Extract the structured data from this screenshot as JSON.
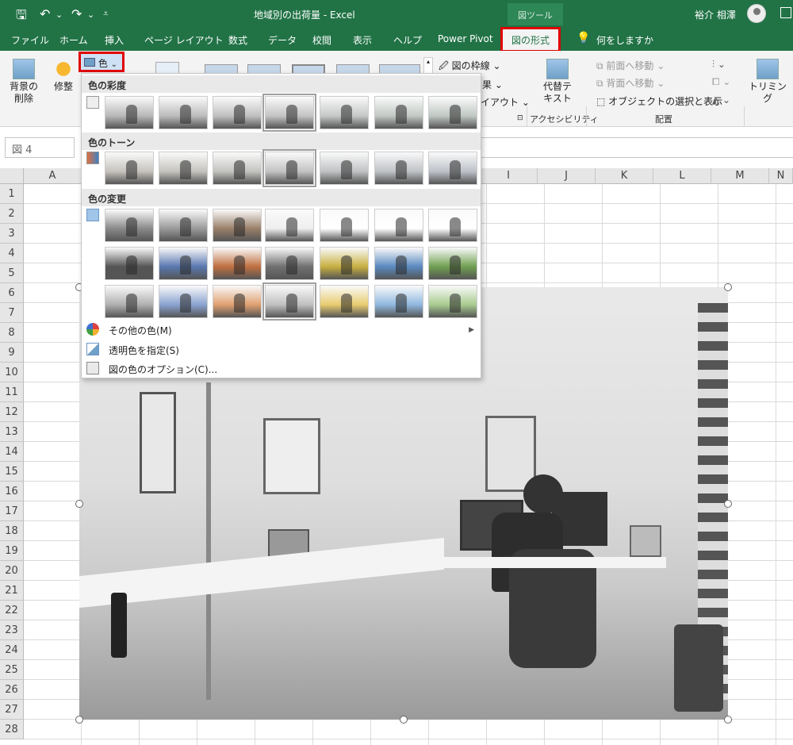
{
  "titlebar": {
    "save": "🖫",
    "undo": "↶",
    "undo_arrow": "⌄",
    "redo": "↷",
    "redo_arrow": "⌄",
    "customize": "⩡",
    "title": "地域別の出荷量 - Excel",
    "context": "図ツール",
    "user": "裕介 相澤"
  },
  "tabs": [
    "ファイル",
    "ホーム",
    "挿入",
    "ページ レイアウト",
    "数式",
    "データ",
    "校閲",
    "表示",
    "ヘルプ",
    "Power Pivot",
    "図の形式",
    "何をしますか"
  ],
  "ribbon": {
    "remove_bg": "背景の\n削除",
    "corrections": "修整",
    "color": "色",
    "color_arrow": "⌄",
    "border": "図の枠線",
    "effects": "果",
    "layout": "イアウト",
    "alt_text": "代替テ\nキスト",
    "accessibility": "アクセシビリティ",
    "bring_forward": "前面へ移動",
    "send_backward": "背面へ移動",
    "selection_pane": "オブジェクトの選択と表示",
    "arrange": "配置",
    "crop": "トリミング"
  },
  "namebox": "図 4",
  "columns": [
    "A",
    "",
    "",
    "",
    "",
    "",
    "",
    "",
    "I",
    "J",
    "K",
    "L",
    "M",
    "N"
  ],
  "rows": [
    "1",
    "2",
    "3",
    "4",
    "5",
    "6",
    "7",
    "8",
    "9",
    "10",
    "11",
    "12",
    "13",
    "14",
    "15",
    "16",
    "17",
    "18",
    "19",
    "20",
    "21",
    "22",
    "23",
    "24",
    "25",
    "26",
    "27",
    "28"
  ],
  "dropdown": {
    "saturation": "色の彩度",
    "tone": "色のトーン",
    "recolor": "色の変更",
    "more_colors": "その他の色(M)",
    "transparent": "透明色を指定(S)",
    "options": "図の色のオプション(C)...",
    "submenu_arrow": "▶"
  },
  "swatches": {
    "saturation": [
      "#b8b8b8",
      "#bcbcbc",
      "#c0c0c0",
      "#c4c4c4",
      "#c4c8c6",
      "#c2c8c4",
      "#c0c9c3"
    ],
    "tone": [
      "#c6c3bd",
      "#c4c3be",
      "#c3c3c0",
      "#c2c3c2",
      "#c0c2c4",
      "#bfc2c6",
      "#bdc1c8"
    ],
    "recolor": [
      "#8a8a8a",
      "#9a9a9a",
      "#9a806a",
      "#efefef",
      "#ffffff",
      "#ffffff",
      "#ffffff",
      "#555555",
      "#5a78b0",
      "#c07040",
      "#707070",
      "#c8b040",
      "#5a8ac0",
      "#70a050",
      "#b0b0b0",
      "#8aa3d0",
      "#e0a070",
      "#c0c0c0",
      "#e8cc70",
      "#90b8e0",
      "#a8cc90"
    ],
    "colors": {
      "accent": "#217346",
      "highlight": "#e00000"
    }
  }
}
